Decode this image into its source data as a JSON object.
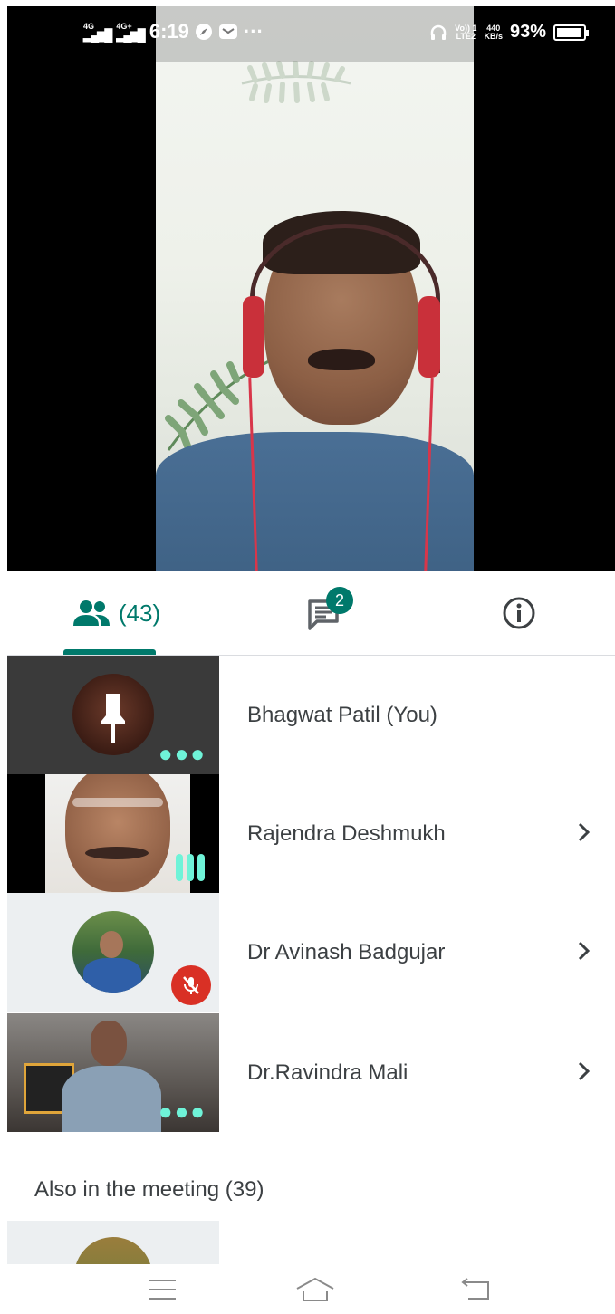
{
  "status": {
    "time": "6:19",
    "net1": "4G",
    "net2": "4G+",
    "more": "···",
    "volte": "Vo)) 1",
    "lte": "LTE2",
    "speed_value": "440",
    "speed_unit": "KB/s",
    "battery": "93%",
    "battery_level": 0.93
  },
  "tabs": {
    "people_count": "(43)",
    "chat_badge": "2"
  },
  "participants": [
    {
      "name": "Bhagwat Patil (You)"
    },
    {
      "name": "Rajendra Deshmukh"
    },
    {
      "name": "Dr Avinash Badgujar"
    },
    {
      "name": "Dr.Ravindra Mali"
    }
  ],
  "also_in_meeting": "Also in the meeting (39)",
  "icons": {
    "people": "people-icon",
    "chat": "chat-icon",
    "info": "info-icon",
    "chevron": "chevron-right-icon",
    "mic_off": "mic-off-icon",
    "pin": "pin-icon"
  },
  "colors": {
    "accent": "#00796b",
    "mic_off": "#d93025",
    "audio_level": "#6ff3d8"
  }
}
